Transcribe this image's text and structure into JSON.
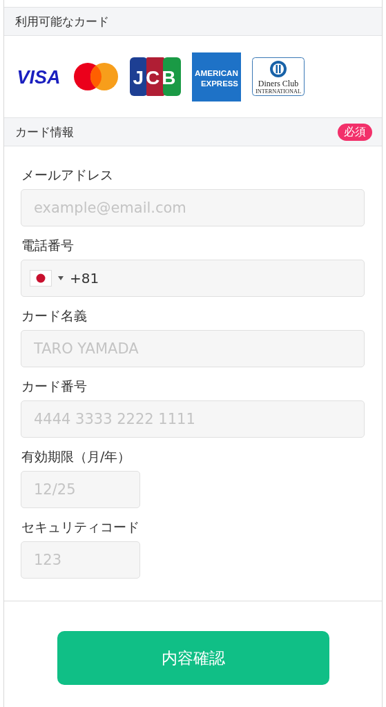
{
  "cards_section": {
    "title": "利用可能なカード",
    "cards": [
      {
        "kind": "visa",
        "lines": [
          "VISA"
        ]
      },
      {
        "kind": "mastercard"
      },
      {
        "kind": "jcb",
        "lines": [
          "JCB"
        ]
      },
      {
        "kind": "amex",
        "lines": [
          "AMERICAN",
          "EXPRESS"
        ]
      },
      {
        "kind": "diners",
        "lines": [
          "Diners Club",
          "INTERNATIONAL"
        ]
      }
    ]
  },
  "form_section": {
    "title": "カード情報",
    "badge": "必須",
    "fields": [
      {
        "kind": "text",
        "label": "メールアドレス",
        "placeholder": "example@email.com",
        "short": false
      },
      {
        "kind": "phone",
        "label": "電話番号",
        "value": "+81",
        "short": false
      },
      {
        "kind": "text",
        "label": "カード名義",
        "placeholder": "TARO YAMADA",
        "short": false
      },
      {
        "kind": "text",
        "label": "カード番号",
        "placeholder": "4444 3333 2222 1111",
        "short": false
      },
      {
        "kind": "text",
        "label": "有効期限（月/年）",
        "placeholder": "12/25",
        "short": true
      },
      {
        "kind": "text",
        "label": "セキュリティコード",
        "placeholder": "123",
        "short": true
      }
    ]
  },
  "confirm_button": "内容確認"
}
